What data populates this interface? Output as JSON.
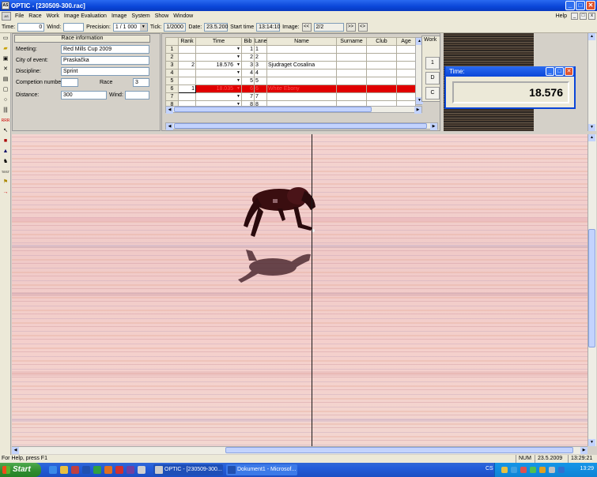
{
  "window": {
    "title": "OPTIC - [230509-300.rac]",
    "app_icon": "app-icon"
  },
  "menu": {
    "items": [
      "File",
      "Race",
      "Work",
      "Image Evaluation",
      "Image",
      "System",
      "Show",
      "Window"
    ],
    "help": "Help"
  },
  "toolbar": {
    "time_label": "Time:",
    "time_value": "0",
    "wind_label": "Wind:",
    "wind_value": "",
    "precision_label": "Precision:",
    "precision_value": "1 / 1 000",
    "tick_label": "Tick:",
    "tick_value": "1/2000",
    "date_label": "Date:",
    "date_value": "23.5.200",
    "start_label": "Start time",
    "start_value": "13:14:10",
    "image_label": "Image:",
    "image_prev": "<<",
    "image_value": "2/2",
    "image_next": ">>",
    "image_extra": "<>"
  },
  "race_info": {
    "header": "Race information",
    "meeting_label": "Meeting:",
    "meeting_value": "Red Mills Cup 2009",
    "city_label": "City of event:",
    "city_value": "Praskačka",
    "discipline_label": "Discipline:",
    "discipline_value": "Sprint",
    "competition_label": "Competion number:",
    "competition_value": "",
    "race_label": "Race",
    "race_value": "3",
    "distance_label": "Distance:",
    "distance_value": "300",
    "wind_label": "Wind:",
    "wind_value": ""
  },
  "grid": {
    "columns": [
      "",
      "Rank",
      "Time",
      "Bib",
      "Lane",
      "Name",
      "Surname",
      "Club",
      "Age"
    ],
    "rows": [
      {
        "n": "1",
        "rank": "",
        "time": "",
        "bib": "1",
        "lane": "1",
        "name": ""
      },
      {
        "n": "2",
        "rank": "",
        "time": "",
        "bib": "2",
        "lane": "2",
        "name": ""
      },
      {
        "n": "3",
        "rank": "2",
        "time": "18.576",
        "bib": "3",
        "lane": "3",
        "name": "Sjudraget Cosalina"
      },
      {
        "n": "4",
        "rank": "",
        "time": "",
        "bib": "4",
        "lane": "4",
        "name": ""
      },
      {
        "n": "5",
        "rank": "",
        "time": "",
        "bib": "5",
        "lane": "5",
        "name": ""
      },
      {
        "n": "6",
        "rank": "1",
        "time": "18.035",
        "bib": "6",
        "lane": "6",
        "name": "White Ebony"
      },
      {
        "n": "7",
        "rank": "",
        "time": "",
        "bib": "7",
        "lane": "7",
        "name": ""
      },
      {
        "n": "8",
        "rank": "",
        "time": "",
        "bib": "8",
        "lane": "8",
        "name": ""
      }
    ]
  },
  "work": {
    "label": "Work",
    "buttons": [
      "1",
      "D",
      "C"
    ]
  },
  "time_window": {
    "title": "Time:",
    "value": "18.576"
  },
  "status": {
    "help": "For Help, press F1",
    "num": "NUM",
    "date": "23.5.2009",
    "time": "13:29:21"
  },
  "taskbar": {
    "start": "Start",
    "tasks": [
      "OPTIC - [230509-300...",
      "Dokument1 - Microsof..."
    ],
    "lang": "CS",
    "clock": "13:29"
  }
}
